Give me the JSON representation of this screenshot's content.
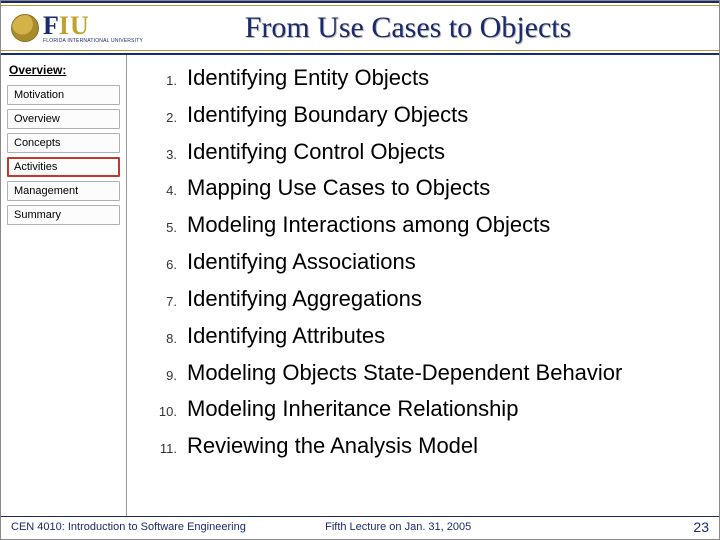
{
  "brand": {
    "letters_f": "F",
    "letters_iu": "IU",
    "sub": "FLORIDA INTERNATIONAL UNIVERSITY"
  },
  "title": "From Use Cases to Objects",
  "sidebar": {
    "heading": "Overview:",
    "items": [
      {
        "label": "Motivation",
        "active": false
      },
      {
        "label": "Overview",
        "active": false
      },
      {
        "label": "Concepts",
        "active": false
      },
      {
        "label": "Activities",
        "active": true
      },
      {
        "label": "Management",
        "active": false
      },
      {
        "label": "Summary",
        "active": false
      }
    ]
  },
  "list": [
    "Identifying Entity Objects",
    "Identifying Boundary Objects",
    "Identifying Control Objects",
    "Mapping Use Cases to Objects",
    "Modeling Interactions among Objects",
    "Identifying Associations",
    "Identifying Aggregations",
    "Identifying Attributes",
    "Modeling Objects State-Dependent Behavior",
    "Modeling Inheritance Relationship",
    "Reviewing the Analysis Model"
  ],
  "footer": {
    "course": "CEN 4010: Introduction to Software Engineering",
    "lecture": "Fifth Lecture on Jan. 31, 2005",
    "page": "23"
  }
}
